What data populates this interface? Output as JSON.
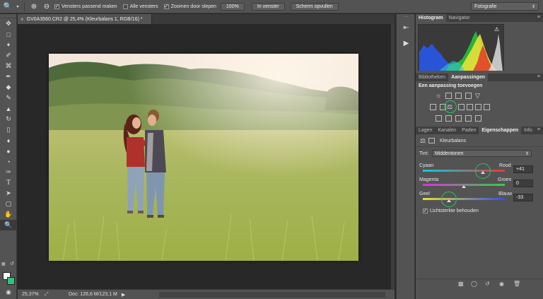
{
  "options_bar": {
    "tool_icon": "zoom-icon",
    "chk_fit_windows": "Vensters passend maken",
    "chk_all_windows": "Alle vensters",
    "chk_scrubby_zoom": "Zoomen door slepen",
    "btn_100": "100%",
    "btn_fit": "In venster",
    "btn_fill": "Scherm opvullen",
    "workspace": "Fotografie"
  },
  "document": {
    "tab_title": "GV0A3560.CR2 @ 25,4% (Kleurbalans 1, RGB/16) *"
  },
  "status": {
    "zoom": "25,37%",
    "doc_size": "Doc: 126,6 M/123,1 M"
  },
  "panels": {
    "top_tabs": [
      "Histogram",
      "Navigator"
    ],
    "mid_tabs": [
      "Bibliotheken",
      "Aanpassingen"
    ],
    "adjust_title": "Een aanpassing toevoegen",
    "prop_tabs": [
      "Lagen",
      "Kanalen",
      "Paden",
      "Eigenschappen",
      "Info"
    ],
    "prop_title": "Kleurbalans",
    "tint_label": "Tint:",
    "tint_value": "Middentonen",
    "cyan": "Cyaan",
    "red": "Rood",
    "magenta": "Magenta",
    "green": "Groen",
    "yellow": "Geel",
    "blue": "Blauw",
    "val_cyan_red": "+41",
    "val_magenta_green": "0",
    "val_yellow_blue": "-33",
    "preserve_lum": "Lichtsterkte behouden"
  },
  "colors": {
    "accent_ring": "#2fbf6a",
    "panel_bg": "#535353",
    "canvas_bg": "#282828"
  }
}
